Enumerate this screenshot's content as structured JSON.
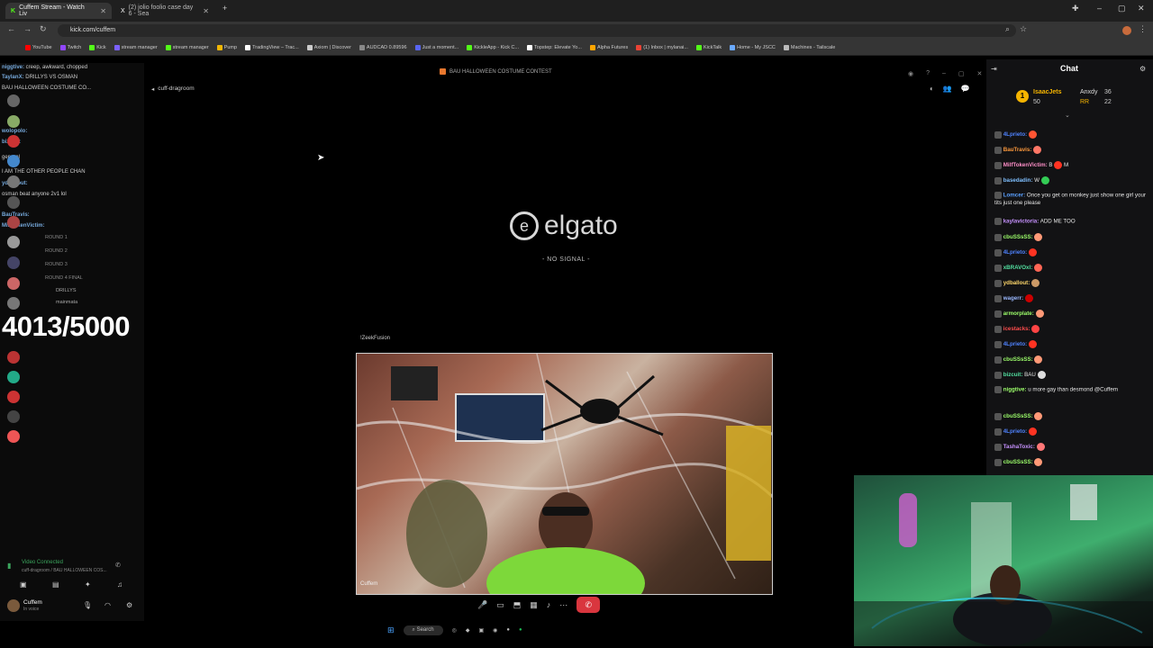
{
  "browser": {
    "tabs": [
      {
        "title": "Cuffem Stream - Watch Liv",
        "active": true
      },
      {
        "title": "(2) jolio foolio case day 6 - Sea",
        "active": false
      }
    ],
    "url": "kick.com/cuffem",
    "bookmarks": [
      "YouTube",
      "Twitch",
      "Kick",
      "stream manager",
      "stream manager",
      "Pump",
      "TradingView – Trac...",
      "Axiom | Discover",
      "AUDCAD 0.89596",
      "Just a moment...",
      "KickleApp - Kick C...",
      "Topstep: Elevate Yo...",
      "Alpha Futures",
      "(1) Inbox | mylanai...",
      "KickTalk",
      "Home - My JSCC",
      "Machines - Tailscale"
    ]
  },
  "discord": {
    "overlay_lines": [
      {
        "user": "niggtive:",
        "text": "creep, awkward, chopped"
      },
      {
        "user": "TaylanX:",
        "text": "DRILLYS VS OSMAN"
      },
      {
        "user": "",
        "text": "BAU HALLOWEEN COSTUME CO..."
      },
      {
        "user": "wolopolo:",
        "text": ""
      },
      {
        "user": "bizcuit:",
        "text": ""
      },
      {
        "user": "",
        "text": "general"
      },
      {
        "user": "",
        "text": "I AM THE OTHER PEOPLE CHAN"
      },
      {
        "user": "ydballout:",
        "text": ""
      },
      {
        "user": "",
        "text": "osman beat anyone 2v1 lol"
      },
      {
        "user": "BauTravis:",
        "text": ""
      },
      {
        "user": "MilfTokenVictim:",
        "text": ""
      }
    ],
    "rounds": [
      "ROUND 1",
      "ROUND 2",
      "ROUND 3",
      "ROUND 4 FINAL"
    ],
    "round_users": [
      "DRILLYS",
      "mainmata"
    ],
    "counter": "4013/5000",
    "voice_status": "Video Connected",
    "voice_channel": "cuff-dragroom / BAU HALLOWEEN COS...",
    "user_name": "Cuffem",
    "user_status": "In voice"
  },
  "stage": {
    "title": "BAU HALLOWEEN COSTUME CONTEST",
    "channel": "cuff-dragroom",
    "elgato_text": "elgato",
    "no_signal": "- NO SIGNAL -",
    "stream_label": "!ZeekFusion",
    "cam_name": "Cuffem"
  },
  "taskbar": {
    "search": "Search"
  },
  "chat": {
    "title": "Chat",
    "leaderboard": [
      {
        "name": "IsaacJets",
        "value": "50"
      },
      {
        "name": "Anxdy",
        "value": "36"
      },
      {
        "name": "RR",
        "value": "22"
      }
    ],
    "messages": [
      {
        "user": "4Lprieto:",
        "text": "",
        "color": "#4f83ff"
      },
      {
        "user": "BauTravis:",
        "text": "",
        "color": "#ff9a3c"
      },
      {
        "user": "MilfTokenVictim:",
        "text": "B",
        "trail": "M",
        "color": "#ff8fc8"
      },
      {
        "user": "basedadin:",
        "text": "W",
        "color": "#7fbfff"
      },
      {
        "user": "Lomcer:",
        "text": "Once you get on monkey just show one girl your tits just one please",
        "color": "#5aa0ff"
      },
      {
        "user": "kaylavictoria:",
        "text": "ADD ME TOO",
        "color": "#c792ff"
      },
      {
        "user": "cbuSSsSS:",
        "text": "",
        "color": "#9dff6b"
      },
      {
        "user": "4Lprieto:",
        "text": "",
        "color": "#4f83ff"
      },
      {
        "user": "xBRAVOxl:",
        "text": "",
        "color": "#52e0a0"
      },
      {
        "user": "ydballout:",
        "text": "",
        "color": "#ffd86b"
      },
      {
        "user": "wagerr:",
        "text": "",
        "color": "#9ab8ff"
      },
      {
        "user": "armorplate:",
        "text": "",
        "color": "#9dff6b"
      },
      {
        "user": "icestacks:",
        "text": "",
        "color": "#ff4d4d"
      },
      {
        "user": "4Lprieto:",
        "text": "",
        "color": "#4f83ff"
      },
      {
        "user": "cbuSSsSS:",
        "text": "",
        "color": "#9dff6b"
      },
      {
        "user": "bizcuit:",
        "text": "BAU",
        "color": "#52e0a0"
      },
      {
        "user": "niggtive:",
        "text": "u more gay than desmond @Cuffem",
        "color": "#9dff6b"
      },
      {
        "user": "cbuSSsSS:",
        "text": "",
        "color": "#9dff6b"
      },
      {
        "user": "4Lprieto:",
        "text": "",
        "color": "#4f83ff"
      },
      {
        "user": "TashaToxic:",
        "text": "",
        "color": "#c792ff"
      },
      {
        "user": "cbuSSsSS:",
        "text": "",
        "color": "#9dff6b"
      }
    ]
  },
  "colors": {
    "accent_red": "#d9363e",
    "chat_bg": "#121214",
    "kick_green": "#53fc18"
  }
}
